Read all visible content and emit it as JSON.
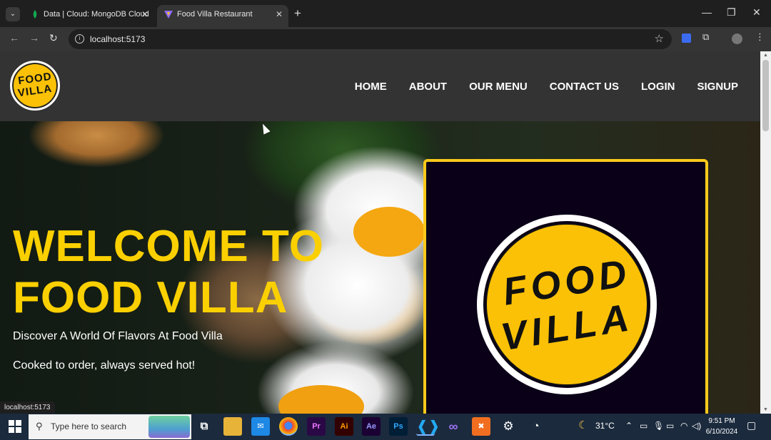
{
  "browser": {
    "tabs": [
      {
        "title": "Data | Cloud: MongoDB Cloud",
        "active": false,
        "favicon": "mongodb-leaf-icon"
      },
      {
        "title": "Food Villa Restaurant",
        "active": true,
        "favicon": "vite-icon"
      }
    ],
    "url": "localhost:5173",
    "status_url": "localhost:5173"
  },
  "site": {
    "logo": {
      "line1": "FOOD",
      "line2": "VILLA"
    },
    "nav": [
      "HOME",
      "ABOUT",
      "OUR MENU",
      "CONTACT US",
      "LOGIN",
      "SIGNUP"
    ],
    "hero": {
      "title_line1": "WELCOME TO",
      "title_line2": "FOOD VILLA",
      "tagline1": "Discover A World Of Flavors At Food Villa",
      "tagline2": "Cooked to order, always served hot!"
    },
    "card_logo": {
      "line1": "FOOD",
      "line2": "VILLA"
    }
  },
  "taskbar": {
    "search_placeholder": "Type here to search",
    "weather": "31°C",
    "time": "9:51 PM",
    "date": "6/10/2024"
  },
  "colors": {
    "accent_yellow": "#fbc106",
    "header_bg": "#333333",
    "card_bg": "#0a0018"
  }
}
